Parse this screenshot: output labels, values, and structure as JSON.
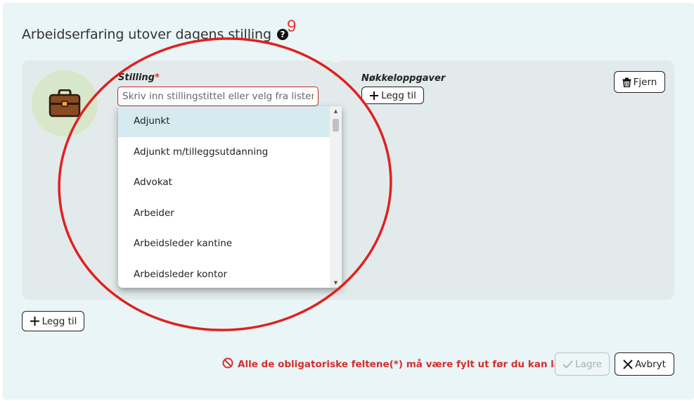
{
  "section": {
    "heading": "Arbeidserfaring utover dagens stilling",
    "help_icon": "question-circle-icon"
  },
  "annotation": {
    "number": "9",
    "color": "#e53935"
  },
  "card": {
    "avatar_icon": "briefcase-icon",
    "stilling_label": "Stilling",
    "required_mark": "*",
    "stilling_placeholder": "Skriv inn stillingstittel eller velg fra listen",
    "stilling_value": "",
    "oppgaver_label": "Nøkkeloppgaver",
    "oppgaver_add_label": "Legg til",
    "remove_label": "Fjern"
  },
  "dropdown": {
    "options": [
      "Adjunkt",
      "Adjunkt m/tilleggsutdanning",
      "Advokat",
      "Arbeider",
      "Arbeidsleder kantine",
      "Arbeidsleder kontor"
    ],
    "highlighted_index": 0
  },
  "footer": {
    "add_label": "Legg til",
    "error_message": "Alle de obligatoriske feltene(*) må være fylt ut før du kan lagre",
    "save_label": "Lagre",
    "cancel_label": "Avbryt"
  },
  "colors": {
    "panel_bg": "#e9f5f6",
    "card_bg": "#e2eaeb",
    "error": "#d32f2f",
    "highlight": "#d6ebf0"
  }
}
